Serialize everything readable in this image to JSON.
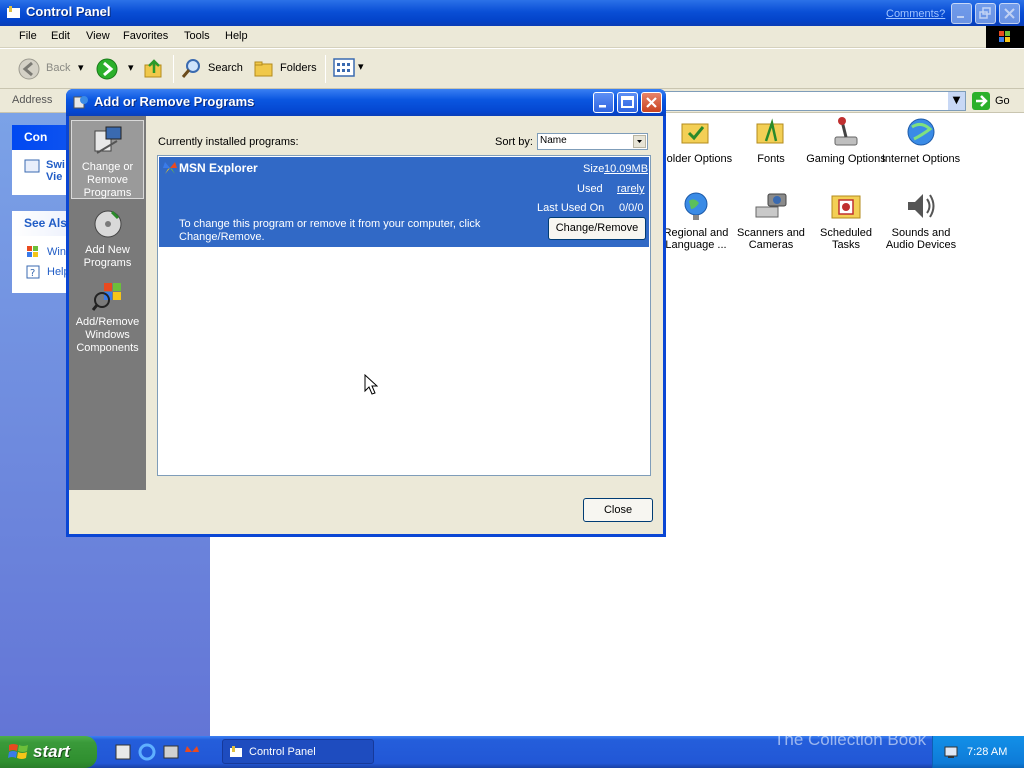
{
  "control_panel": {
    "title": "Control Panel",
    "comments_link": "Comments?",
    "menu": [
      "File",
      "Edit",
      "View",
      "Favorites",
      "Tools",
      "Help"
    ],
    "toolbar": {
      "back": "Back",
      "search": "Search",
      "folders": "Folders"
    },
    "address_label": "Address",
    "go_label": "Go",
    "left_pane": {
      "box1_title": "Con",
      "box1_link_line1": "Swi",
      "box1_link_line2": "Vie",
      "box2_title": "See Als",
      "box2_link1": "Win",
      "box2_link2": "Help"
    },
    "icons": [
      {
        "label": "Folder Options",
        "icon": "folder-options-icon"
      },
      {
        "label": "Fonts",
        "icon": "fonts-icon"
      },
      {
        "label": "Gaming Options",
        "icon": "gaming-options-icon"
      },
      {
        "label": "Internet Options",
        "icon": "internet-options-icon"
      },
      {
        "label": "Regional and Language ...",
        "icon": "regional-icon"
      },
      {
        "label": "Scanners and Cameras",
        "icon": "scanners-icon"
      },
      {
        "label": "Scheduled Tasks",
        "icon": "scheduled-tasks-icon"
      },
      {
        "label": "Sounds and Audio Devices",
        "icon": "sounds-icon"
      }
    ]
  },
  "dialog": {
    "title": "Add or Remove Programs",
    "sidebar": [
      {
        "label": "Change or Remove Programs",
        "active": true
      },
      {
        "label": "Add New Programs",
        "active": false
      },
      {
        "label": "Add/Remove Windows Components",
        "active": false
      }
    ],
    "installed_label": "Currently installed programs:",
    "sort_label": "Sort by:",
    "sort_value": "Name",
    "program": {
      "name": "MSN Explorer",
      "size_label": "Size",
      "size_value": "10.09MB",
      "used_label": "Used",
      "used_value": "rarely",
      "last_used_label": "Last Used On",
      "last_used_value": "0/0/0",
      "description": "To change this program or remove it from your computer, click Change/Remove.",
      "change_button": "Change/Remove"
    },
    "close_button": "Close"
  },
  "taskbar": {
    "start": "start",
    "task_label": "Control Panel",
    "clock": "7:28 AM",
    "watermark": "The Collection Book"
  },
  "colors": {
    "title_blue": "#0a4fd6",
    "selection_blue": "#3169c6",
    "start_green": "#3a9a3a",
    "sidebar_gray": "#7a7a7a"
  }
}
